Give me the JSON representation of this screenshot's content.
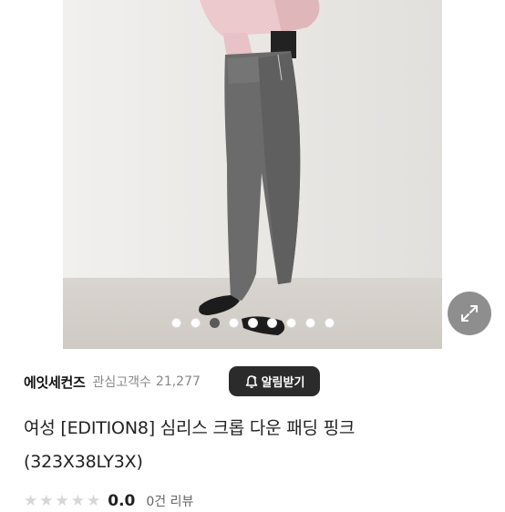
{
  "carousel": {
    "slide_count": 9,
    "active_index": 2
  },
  "seller": {
    "name": "에잇세컨즈",
    "followers_label": "관심고객수",
    "followers_count": "21,277",
    "alarm_button_label": "알림받기",
    "alarm_icon": "bell-plus-icon"
  },
  "product": {
    "title_line1": "여성 [EDITION8] 심리스 크롭 다운 패딩 핑크",
    "title_line2": "(323X38LY3X)"
  },
  "rating": {
    "stars": 0,
    "value": "0.0",
    "review_count": "0건 리뷰"
  },
  "colors": {
    "active_dot": "#5a5a5a",
    "alarm_button_bg": "#2b2b2b",
    "expand_button_bg": "#8e8e8e"
  }
}
